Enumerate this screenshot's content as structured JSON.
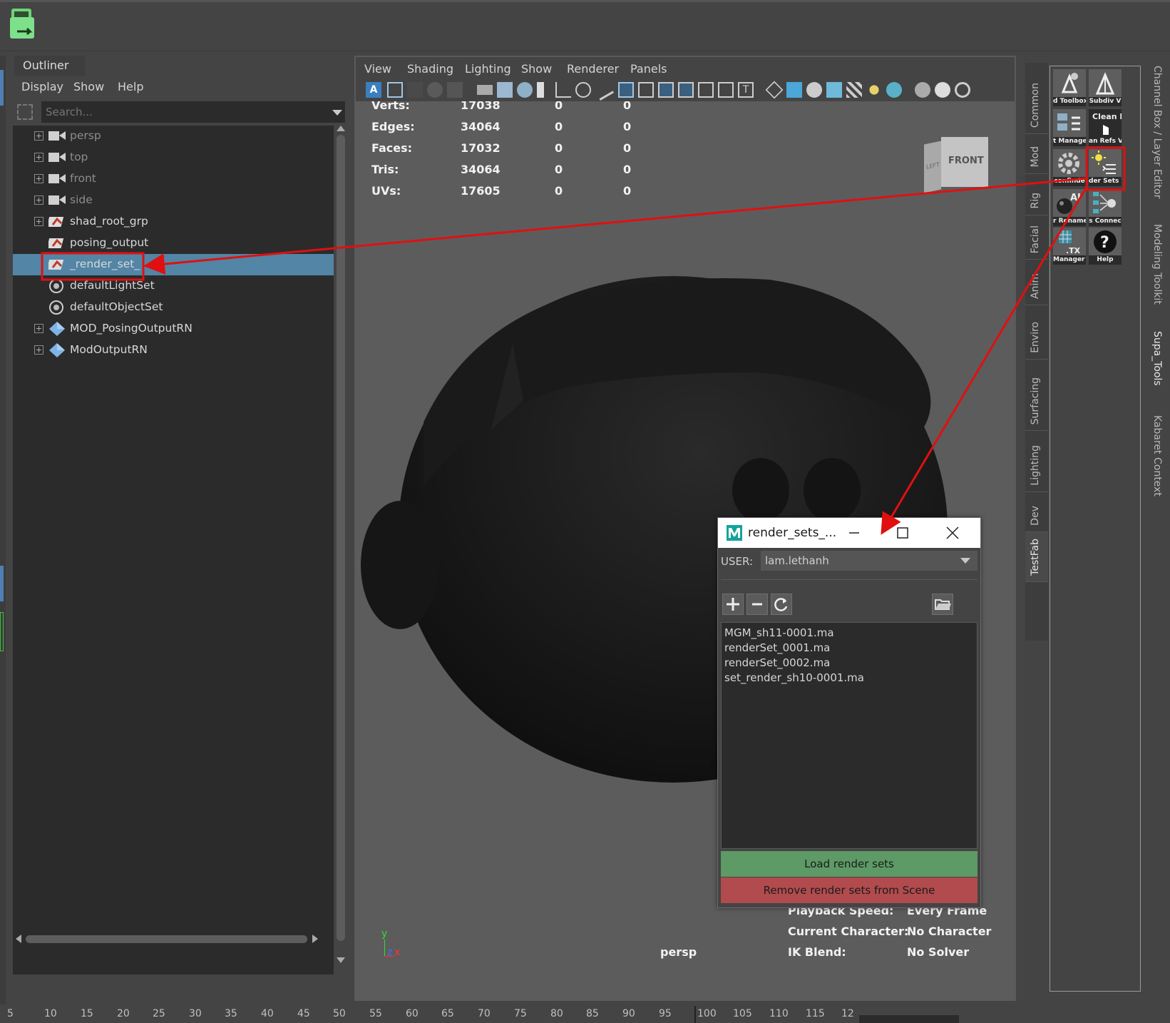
{
  "outliner": {
    "tab_label": "Outliner",
    "menus": [
      "Display",
      "Show",
      "Help"
    ],
    "search_placeholder": "Search...",
    "items": [
      {
        "label": "persp",
        "icon": "camera-icon",
        "expandable": true,
        "dim": true
      },
      {
        "label": "top",
        "icon": "camera-icon",
        "expandable": true,
        "dim": true
      },
      {
        "label": "front",
        "icon": "camera-icon",
        "expandable": true,
        "dim": true
      },
      {
        "label": "side",
        "icon": "camera-icon",
        "expandable": true,
        "dim": true
      },
      {
        "label": "shad_root_grp",
        "icon": "set-icon",
        "expandable": true,
        "dim": false
      },
      {
        "label": "posing_output",
        "icon": "set-icon",
        "expandable": false,
        "dim": false
      },
      {
        "label": "_render_set_",
        "icon": "set-icon",
        "expandable": false,
        "dim": false,
        "selected": true
      },
      {
        "label": "defaultLightSet",
        "icon": "light-set-icon",
        "expandable": false,
        "dim": false
      },
      {
        "label": "defaultObjectSet",
        "icon": "object-set-icon",
        "expandable": false,
        "dim": false
      },
      {
        "label": "MOD_PosingOutputRN",
        "icon": "reference-icon",
        "expandable": true,
        "dim": false
      },
      {
        "label": "ModOutputRN",
        "icon": "reference-icon",
        "expandable": true,
        "dim": false
      }
    ]
  },
  "viewport": {
    "menus": [
      "View",
      "Shading",
      "Lighting",
      "Show",
      "Renderer",
      "Panels"
    ],
    "stats": [
      {
        "label": "Verts:",
        "v1": "17038",
        "v2": "0",
        "v3": "0"
      },
      {
        "label": "Edges:",
        "v1": "34064",
        "v2": "0",
        "v3": "0"
      },
      {
        "label": "Faces:",
        "v1": "17032",
        "v2": "0",
        "v3": "0"
      },
      {
        "label": "Tris:",
        "v1": "34064",
        "v2": "0",
        "v3": "0"
      },
      {
        "label": "UVs:",
        "v1": "17605",
        "v2": "0",
        "v3": "0"
      }
    ],
    "viewcube": {
      "front": "FRONT",
      "left": "LEFT"
    },
    "camera_name": "persp",
    "hud_bottom": [
      {
        "label": "Playback Speed:",
        "value": "Every Frame"
      },
      {
        "label": "Current Character:",
        "value": "No Character"
      },
      {
        "label": "IK Blend:",
        "value": "No Solver"
      }
    ],
    "axis": {
      "y": "y",
      "z": "z",
      "x": "x"
    }
  },
  "dialog": {
    "title": "render_sets_...",
    "user_label": "USER:",
    "user_value": "lam.lethanh",
    "files": [
      "MGM_sh11-0001.ma",
      "renderSet_0001.ma",
      "renderSet_0002.ma",
      "set_render_sh10-0001.ma"
    ],
    "load_label": "Load render sets",
    "remove_label": "Remove render sets from Scene",
    "colors": {
      "load": "#5d9a66",
      "remove": "#b14b4e"
    }
  },
  "shelf_tabs": [
    "Common",
    "Mod",
    "Rig",
    "Facial",
    "Anim",
    "Enviro",
    "Surfacing",
    "Lighting",
    "Dev",
    "TestFab"
  ],
  "shelf_tabs_active": "TestFab",
  "tools": [
    {
      "caption": "d Toolbox",
      "icon": "toolbox-icon"
    },
    {
      "caption": "Subdiv V",
      "icon": "subdiv-icon"
    },
    {
      "caption": "t Manage",
      "icon": "manager-icon"
    },
    {
      "caption": "an Refs V",
      "icon": "clean-refs-icon",
      "icon_text": "Clean REF"
    },
    {
      "caption": "confinde",
      "icon": "gear-icon"
    },
    {
      "caption": "der Sets V",
      "icon": "render-sets-icon"
    },
    {
      "caption": "r Rename",
      "icon": "rename-icon",
      "icon_text": "AI"
    },
    {
      "caption": "s Connec",
      "icon": "connect-icon"
    },
    {
      "caption": "Manager V",
      "icon": "tx-manager-icon",
      "icon_text": ".TX"
    },
    {
      "caption": "Help",
      "icon": "help-icon",
      "icon_text": "?"
    }
  ],
  "right_tabs": [
    "Channel Box / Layer Editor",
    "Modeling Toolkit",
    "Supa_Tools",
    "Kabaret Context"
  ],
  "right_tabs_active": "Supa_Tools",
  "timeline": {
    "ticks": [
      "5",
      "10",
      "15",
      "20",
      "25",
      "30",
      "35",
      "40",
      "45",
      "50",
      "55",
      "60",
      "65",
      "70",
      "75",
      "80",
      "85",
      "90",
      "95",
      "100",
      "105",
      "110",
      "115",
      "12"
    ]
  }
}
